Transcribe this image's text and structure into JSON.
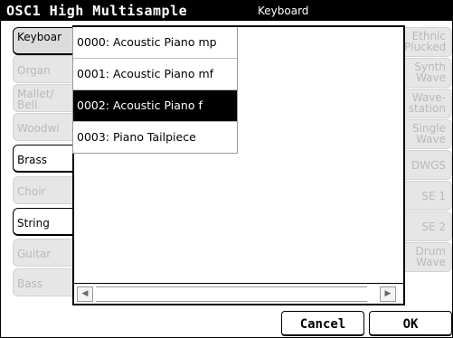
{
  "header": {
    "title": "OSC1 High Multisample",
    "category": "Keyboard"
  },
  "left_tabs": [
    {
      "label": "Keyboar",
      "state": "selected"
    },
    {
      "label": "Organ",
      "state": "disabled"
    },
    {
      "label": "Mallet/ Bell",
      "state": "disabled"
    },
    {
      "label": "Woodwi",
      "state": "disabled"
    },
    {
      "label": "Brass",
      "state": "enabled"
    },
    {
      "label": "Choir",
      "state": "disabled"
    },
    {
      "label": "String",
      "state": "enabled"
    },
    {
      "label": "Guitar",
      "state": "disabled"
    },
    {
      "label": "Bass",
      "state": "disabled"
    }
  ],
  "right_tabs": [
    {
      "label": "Ethnic Plucked"
    },
    {
      "label": "Synth Wave"
    },
    {
      "label": "Wave- station"
    },
    {
      "label": "Single Wave"
    },
    {
      "label": "DWGS"
    },
    {
      "label": "SE 1"
    },
    {
      "label": "SE 2"
    },
    {
      "label": "Drum Wave"
    }
  ],
  "list": {
    "items": [
      {
        "label": "0000: Acoustic Piano mp",
        "selected": false
      },
      {
        "label": "0001: Acoustic Piano mf",
        "selected": false
      },
      {
        "label": "0002: Acoustic Piano f",
        "selected": true
      },
      {
        "label": "0003: Piano Tailpiece",
        "selected": false
      }
    ]
  },
  "scrollbar": {
    "left_arrow": "◀",
    "right_arrow": "▶"
  },
  "buttons": {
    "cancel": "Cancel",
    "ok": "OK"
  }
}
